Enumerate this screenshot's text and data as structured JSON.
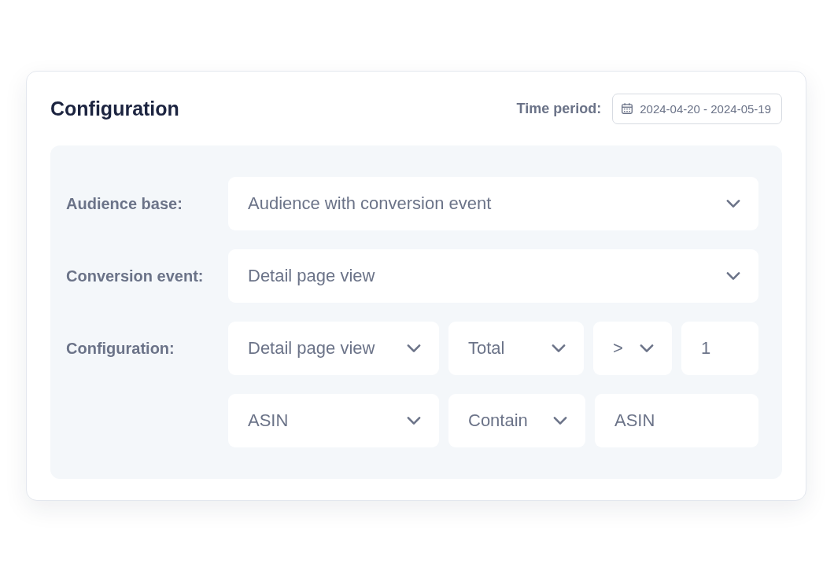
{
  "card": {
    "title": "Configuration",
    "time_period": {
      "label": "Time period:",
      "value": "2024-04-20 - 2024-05-19"
    }
  },
  "fields": [
    {
      "label": "Audience base:",
      "lines": [
        [
          {
            "kind": "select",
            "value": "Audience with conversion event"
          }
        ]
      ]
    },
    {
      "label": "Conversion event:",
      "lines": [
        [
          {
            "kind": "select",
            "value": "Detail page view"
          }
        ]
      ]
    },
    {
      "label": "Configuration:",
      "lines": [
        [
          {
            "kind": "select",
            "value": "Detail page view"
          },
          {
            "kind": "select",
            "value": "Total"
          },
          {
            "kind": "select",
            "value": ">"
          },
          {
            "kind": "input",
            "value": "1"
          }
        ],
        [
          {
            "kind": "select",
            "value": "ASIN"
          },
          {
            "kind": "select",
            "value": "Contain"
          },
          {
            "kind": "input",
            "value": "ASIN"
          }
        ]
      ]
    }
  ]
}
